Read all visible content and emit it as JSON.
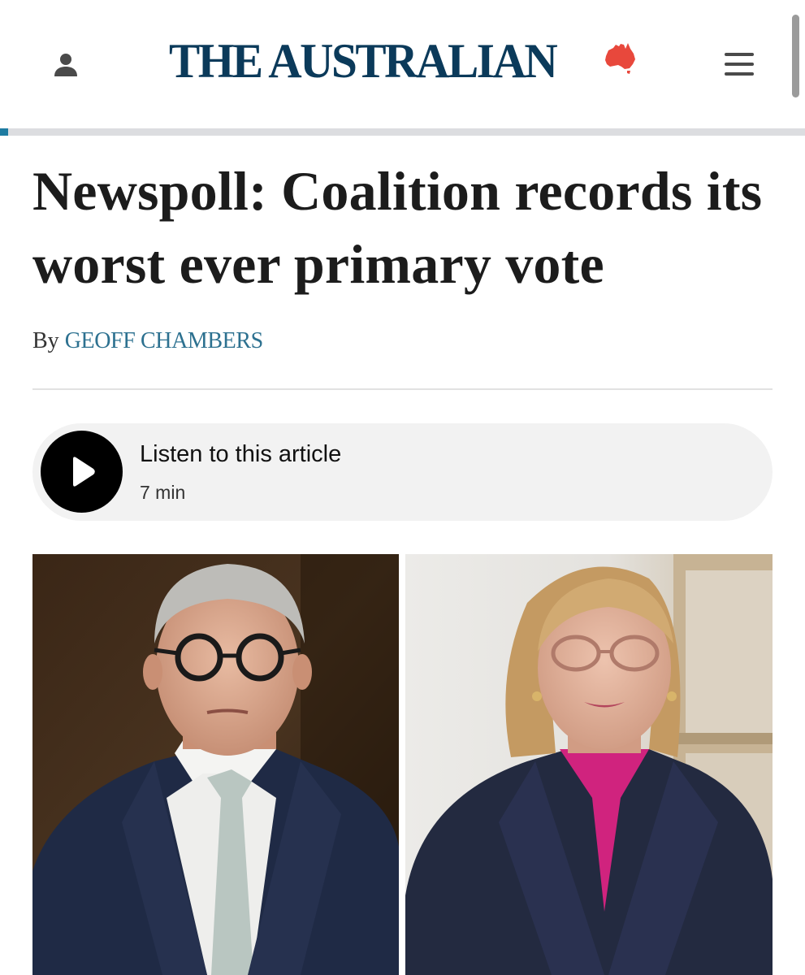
{
  "header": {
    "masthead": "THE AUSTRALIAN",
    "icons": {
      "account": "account-icon",
      "australia_map": "australia-map-icon",
      "menu": "menu-icon"
    },
    "colors": {
      "masthead": "#0b3a5a",
      "map": "#e8483c",
      "icons": "#444444"
    }
  },
  "reading_progress": 0.01,
  "article": {
    "headline": "Newspoll: Coalition records its worst ever primary vote",
    "byline_prefix": "By",
    "author": "GEOFF CHAMBERS",
    "author_color": "#2d7190"
  },
  "audio": {
    "title": "Listen to this article",
    "duration": "7 min",
    "icon": "play-icon"
  },
  "images": [
    {
      "name": "man-portrait-photo"
    },
    {
      "name": "woman-portrait-photo"
    }
  ]
}
